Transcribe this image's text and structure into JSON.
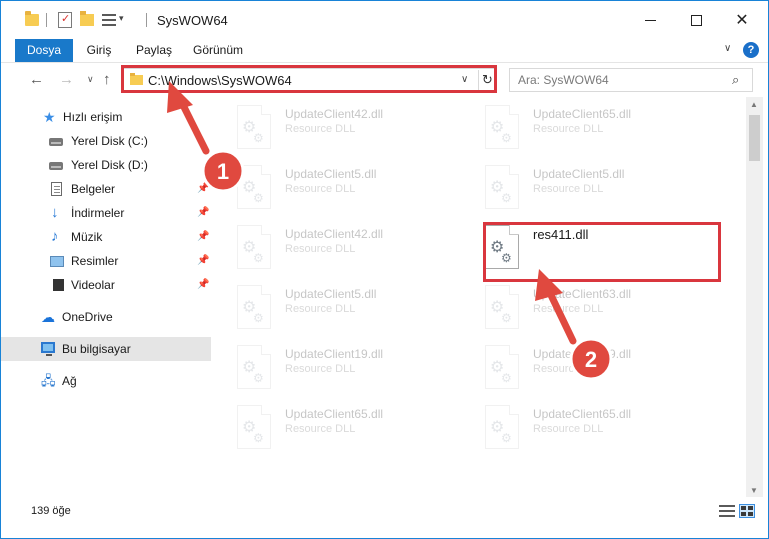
{
  "window": {
    "title": "SysWOW64"
  },
  "ribbon": {
    "tabs": [
      {
        "label": "Dosya"
      },
      {
        "label": "Giriş"
      },
      {
        "label": "Paylaş"
      },
      {
        "label": "Görünüm"
      }
    ],
    "help_label": "?"
  },
  "address_bar": {
    "path": "C:\\Windows\\SysWOW64"
  },
  "search": {
    "placeholder": "Ara: SysWOW64"
  },
  "sidebar": {
    "items": [
      {
        "label": "Hızlı erişim",
        "icon": "star-icon"
      },
      {
        "label": "Yerel Disk (C:)",
        "icon": "drive-icon"
      },
      {
        "label": "Yerel Disk (D:)",
        "icon": "drive-icon"
      },
      {
        "label": "Belgeler",
        "icon": "document-icon",
        "pinned": true
      },
      {
        "label": "İndirmeler",
        "icon": "download-icon",
        "pinned": true
      },
      {
        "label": "Müzik",
        "icon": "music-icon",
        "pinned": true
      },
      {
        "label": "Resimler",
        "icon": "picture-icon",
        "pinned": true
      },
      {
        "label": "Videolar",
        "icon": "video-icon",
        "pinned": true
      },
      {
        "label": "OneDrive",
        "icon": "cloud-icon"
      },
      {
        "label": "Bu bilgisayar",
        "icon": "computer-icon",
        "selected": true
      },
      {
        "label": "Ağ",
        "icon": "network-icon"
      }
    ]
  },
  "files": {
    "items": [
      {
        "name": "UpdateClient42.dll",
        "type": "Resource DLL",
        "faded": true
      },
      {
        "name": "UpdateClient65.dll",
        "type": "Resource DLL",
        "faded": true
      },
      {
        "name": "UpdateClient5.dll",
        "type": "Resource DLL",
        "faded": true
      },
      {
        "name": "UpdateClient5.dll",
        "type": "Resource DLL",
        "faded": true
      },
      {
        "name": "UpdateClient42.dll",
        "type": "Resource DLL",
        "faded": true
      },
      {
        "name": "res411.dll",
        "type": "",
        "faded": false
      },
      {
        "name": "UpdateClient5.dll",
        "type": "Resource DLL",
        "faded": true
      },
      {
        "name": "UpdateClient63.dll",
        "type": "Resource DLL",
        "faded": true
      },
      {
        "name": "UpdateClient19.dll",
        "type": "Resource DLL",
        "faded": true
      },
      {
        "name": "UpdateClient19.dll",
        "type": "Resource DLL",
        "faded": true
      },
      {
        "name": "UpdateClient65.dll",
        "type": "Resource DLL",
        "faded": true
      },
      {
        "name": "UpdateClient65.dll",
        "type": "Resource DLL",
        "faded": true
      }
    ]
  },
  "status": {
    "item_count": "139 öğe"
  },
  "callouts": [
    {
      "number": "1"
    },
    {
      "number": "2"
    }
  ],
  "colors": {
    "accent": "#1979ca",
    "highlight": "#d9363e",
    "selected_row": "#e5e5e5"
  }
}
